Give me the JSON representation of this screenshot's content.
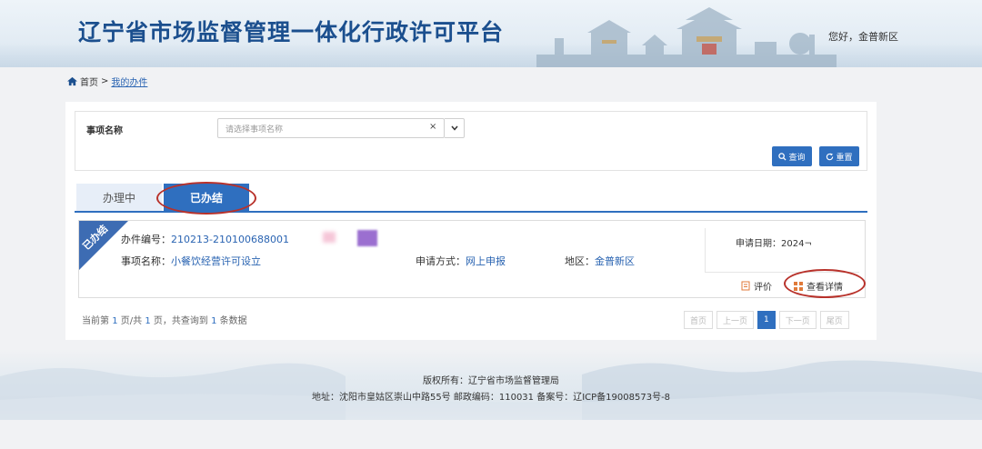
{
  "header": {
    "title": "辽宁省市场监督管理一体化行政许可平台",
    "greeting": "您好，金普新区"
  },
  "breadcrumb": {
    "home": "首页",
    "separator": ">",
    "current": "我的办件"
  },
  "filter": {
    "label": "事项名称",
    "placeholder": "请选择事项名称",
    "clear_glyph": "×",
    "query_label": "查询",
    "reset_label": "重置"
  },
  "tabs": [
    {
      "label": "办理中",
      "active": false
    },
    {
      "label": "已办结",
      "active": true
    }
  ],
  "record": {
    "ribbon": "已办结",
    "case_no_label": "办件编号：",
    "case_no": "210213-210100688001",
    "item_label": "事项名称：",
    "item_name": "小餐饮经营许可设立",
    "method_label": "申请方式：",
    "method": "网上申报",
    "region_label": "地区：",
    "region": "金普新区",
    "date_label": "申请日期：",
    "date": "2024¬",
    "evaluate_label": "评价",
    "detail_label": "查看详情"
  },
  "pagination": {
    "info_prefix": "当前第",
    "current_page": "1",
    "info_mid": "页/共",
    "total_pages": "1",
    "info_mid2": "页，共查询到",
    "total_records": "1",
    "info_suffix": "条数据",
    "first": "首页",
    "prev": "上一页",
    "page": "1",
    "next": "下一页",
    "last": "尾页"
  },
  "footer": {
    "copyright": "版权所有：辽宁省市场监督管理局",
    "address": "地址：沈阳市皇姑区崇山中路55号 邮政编码：110031 备案号：辽ICP备19008573号-8"
  },
  "colors": {
    "brand": "#2f6fbf",
    "title": "#1b4f8e",
    "annotation": "#b8322b"
  }
}
